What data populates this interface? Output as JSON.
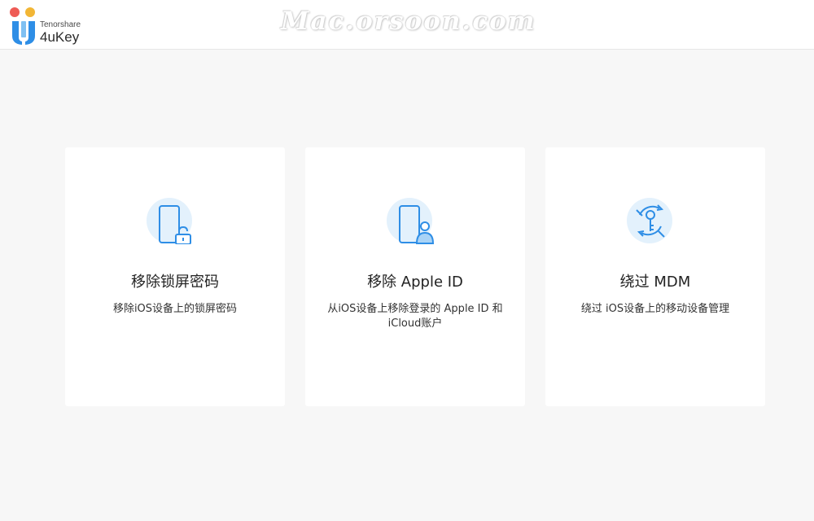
{
  "app": {
    "brand_company": "Tenorshare",
    "brand_product": "4uKey",
    "watermark": "Mac.orsoon.com"
  },
  "colors": {
    "accent": "#2e8ee6",
    "icon_bg": "#e3f1fc",
    "close": "#ee5b55",
    "minimize": "#f2b635"
  },
  "cards": [
    {
      "icon": "phone-unlock-icon",
      "title": "移除锁屏密码",
      "desc": "移除iOS设备上的锁屏密码"
    },
    {
      "icon": "phone-user-icon",
      "title": "移除 Apple ID",
      "desc": "从iOS设备上移除登录的 Apple ID 和iCloud账户"
    },
    {
      "icon": "key-cycle-icon",
      "title": "绕过 MDM",
      "desc": "绕过 iOS设备上的移动设备管理"
    }
  ]
}
